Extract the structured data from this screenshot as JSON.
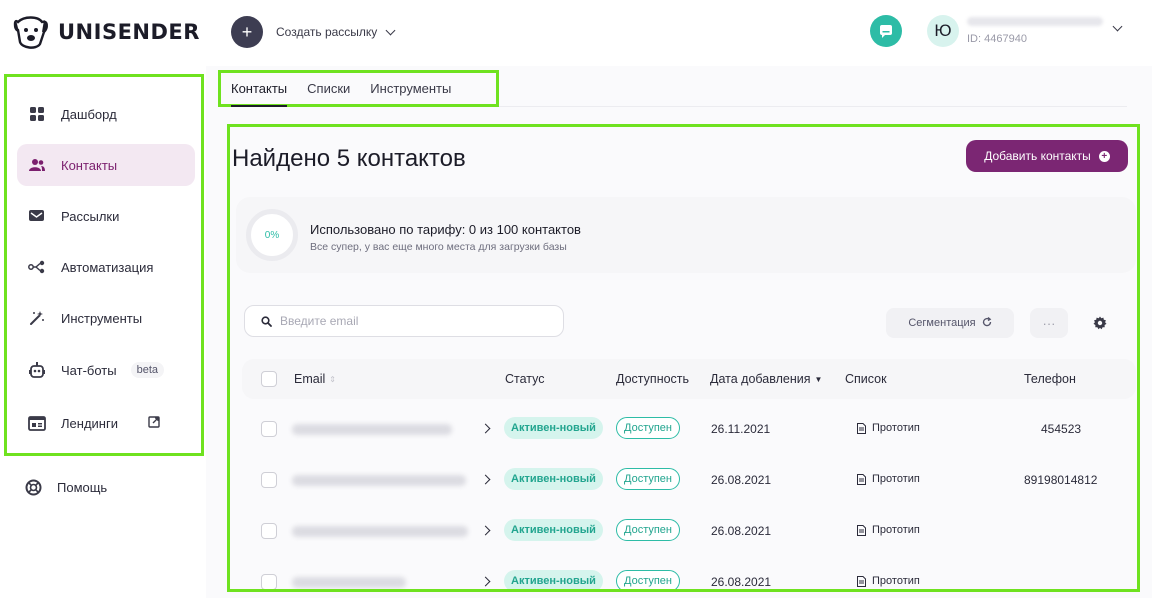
{
  "header": {
    "logo_text": "UNISENDER",
    "create_label": "Создать рассылку",
    "avatar_letter": "Ю",
    "user_id": "ID: 4467940"
  },
  "sidebar": {
    "items": [
      {
        "label": "Дашборд",
        "icon": "dashboard-icon"
      },
      {
        "label": "Контакты",
        "icon": "contacts-icon"
      },
      {
        "label": "Рассылки",
        "icon": "mail-icon"
      },
      {
        "label": "Автоматизация",
        "icon": "automation-icon"
      },
      {
        "label": "Инструменты",
        "icon": "magic-wand-icon"
      },
      {
        "label": "Чат-боты",
        "icon": "bot-icon",
        "badge": "beta"
      },
      {
        "label": "Лендинги",
        "icon": "landing-icon"
      }
    ],
    "help_label": "Помощь"
  },
  "tabs": [
    {
      "label": "Контакты"
    },
    {
      "label": "Списки"
    },
    {
      "label": "Инструменты"
    }
  ],
  "main": {
    "title": "Найдено 5 контактов",
    "add_button": "Добавить контакты",
    "usage": {
      "percent_label": "0%",
      "title": "Использовано по тарифу: 0 из 100 контактов",
      "subtitle": "Все супер, у вас еще много места для загрузки базы"
    },
    "search_placeholder": "Введите email",
    "segmentation_label": "Сегментация",
    "more_label": "···"
  },
  "table": {
    "headers": {
      "email": "Email",
      "status": "Статус",
      "availability": "Доступность",
      "date": "Дата добавления",
      "list": "Список",
      "phone": "Телефон"
    },
    "rows": [
      {
        "status": "Активен-новый",
        "availability": "Доступен",
        "date": "26.11.2021",
        "list": "Прототип",
        "phone": "454523"
      },
      {
        "status": "Активен-новый",
        "availability": "Доступен",
        "date": "26.08.2021",
        "list": "Прототип",
        "phone": "89198014812"
      },
      {
        "status": "Активен-новый",
        "availability": "Доступен",
        "date": "26.08.2021",
        "list": "Прототип",
        "phone": ""
      },
      {
        "status": "Активен-новый",
        "availability": "Доступен",
        "date": "26.08.2021",
        "list": "Прототип",
        "phone": ""
      }
    ]
  },
  "colors": {
    "accent": "#7b2673",
    "teal": "#2dbca6",
    "highlight": "#6fe21f"
  }
}
